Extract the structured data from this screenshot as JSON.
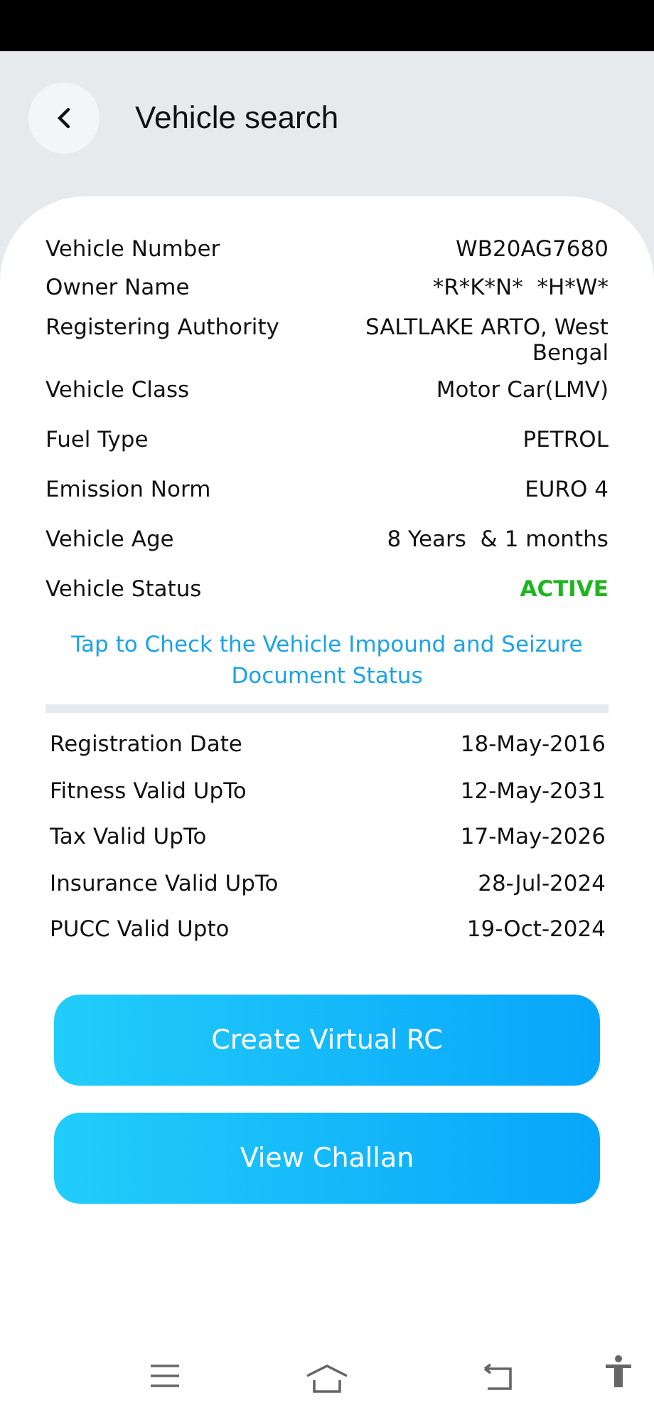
{
  "header": {
    "title": "Vehicle search"
  },
  "details": [
    {
      "kind": "text",
      "label": "Vehicle Number",
      "value": "WB20AG7680"
    },
    {
      "kind": "text",
      "label": "Owner Name",
      "value": "*R*K*N*  *H*W*"
    },
    {
      "kind": "text",
      "label": "Registering Authority",
      "value": "SALTLAKE ARTO, West Bengal"
    },
    {
      "kind": "text",
      "label": "Vehicle Class",
      "value": "Motor Car(LMV)"
    },
    {
      "kind": "text",
      "label": "Fuel Type",
      "value": "PETROL"
    },
    {
      "kind": "text",
      "label": "Emission Norm",
      "value": "EURO 4"
    },
    {
      "kind": "text",
      "label": "Vehicle Age",
      "value": "8 Years  & 1 months"
    },
    {
      "kind": "status",
      "label": "Vehicle Status",
      "value": "ACTIVE"
    }
  ],
  "impound_link": "Tap to Check the Vehicle Impound and Seizure Document Status",
  "dates": [
    {
      "label": "Registration Date",
      "value": "18-May-2016"
    },
    {
      "label": "Fitness Valid UpTo",
      "value": "12-May-2031"
    },
    {
      "label": "Tax Valid UpTo",
      "value": "17-May-2026"
    },
    {
      "label": "Insurance Valid UpTo",
      "value": "28-Jul-2024"
    },
    {
      "label": "PUCC Valid Upto",
      "value": "19-Oct-2024"
    }
  ],
  "buttons": [
    "Create Virtual RC",
    "View Challan"
  ]
}
